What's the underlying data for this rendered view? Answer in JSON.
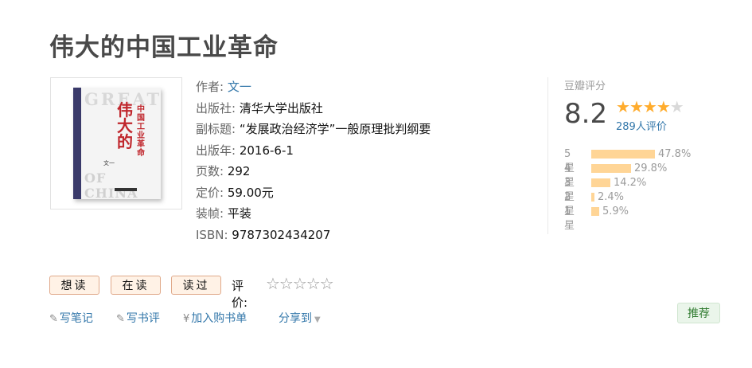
{
  "title": "伟大的中国工业革命",
  "cover": {
    "great": "GREAT",
    "title_cn": "伟大的",
    "title_small": "中国工业革命",
    "of_china": "OF CHINA",
    "author": "文一"
  },
  "info": {
    "author_label": "作者:",
    "author": "文一",
    "publisher_label": "出版社:",
    "publisher": "清华大学出版社",
    "subtitle_label": "副标题:",
    "subtitle": "“发展政治经济学”一般原理批判纲要",
    "pubyear_label": "出版年:",
    "pubyear": "2016-6-1",
    "pages_label": "页数:",
    "pages": "292",
    "price_label": "定价:",
    "price": "59.00元",
    "binding_label": "装帧:",
    "binding": "平装",
    "isbn_label": "ISBN:",
    "isbn": "9787302434207"
  },
  "rating": {
    "label": "豆瓣评分",
    "score": "8.2",
    "stars": 4,
    "count_text": "289人评价",
    "distribution": [
      {
        "label": "5星",
        "percent": 47.8,
        "text": "47.8%"
      },
      {
        "label": "4星",
        "percent": 29.8,
        "text": "29.8%"
      },
      {
        "label": "3星",
        "percent": 14.2,
        "text": "14.2%"
      },
      {
        "label": "2星",
        "percent": 2.4,
        "text": "2.4%"
      },
      {
        "label": "1星",
        "percent": 5.9,
        "text": "5.9%"
      }
    ]
  },
  "actions": {
    "want_read": "想读",
    "reading": "在读",
    "read": "读过",
    "rate_label": "评价:",
    "rate_stars": "☆☆☆☆☆"
  },
  "links": {
    "write_note": "写笔记",
    "write_review": "写书评",
    "add_cart": "加入购书单",
    "share": "分享到",
    "recommend": "推荐"
  },
  "colors": {
    "link": "#3377aa",
    "star": "#ffac2d",
    "bar": "#ffd596",
    "button_bg": "#fff2e6",
    "button_border": "#e0a98a",
    "recommend_bg": "#eaf5ea",
    "recommend_text": "#2e7a2e"
  },
  "icons": {
    "pencil": "pencil-icon",
    "yen": "yen-icon",
    "caret": "caret-down-icon"
  }
}
